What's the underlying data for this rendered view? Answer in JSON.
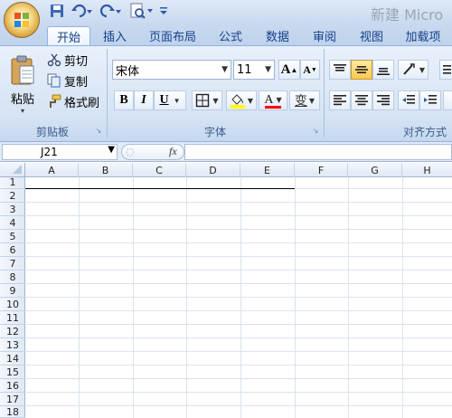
{
  "title_bar": {
    "title": "新建 Micro"
  },
  "tabs": [
    {
      "label": "开始"
    },
    {
      "label": "插入"
    },
    {
      "label": "页面布局"
    },
    {
      "label": "公式"
    },
    {
      "label": "数据"
    },
    {
      "label": "审阅"
    },
    {
      "label": "视图"
    },
    {
      "label": "加载项"
    }
  ],
  "clipboard": {
    "paste_label": "粘贴",
    "cut_label": "剪切",
    "copy_label": "复制",
    "format_painter_label": "格式刷",
    "group_label": "剪贴板"
  },
  "font": {
    "font_name": "宋体",
    "font_size": "11",
    "grow_label": "A",
    "shrink_label": "A",
    "bold_label": "B",
    "italic_label": "I",
    "underline_label": "U",
    "font_color_label": "A",
    "phonetic_label": "变",
    "group_label": "字体"
  },
  "alignment": {
    "group_label": "对齐方式"
  },
  "formula_bar": {
    "name_box": "J21",
    "fx_label": "fx",
    "formula": ""
  },
  "columns": [
    "A",
    "B",
    "C",
    "D",
    "E",
    "F",
    "G",
    "H"
  ],
  "rows": [
    "1",
    "2",
    "3",
    "4",
    "5",
    "6",
    "7",
    "8",
    "9",
    "10",
    "11",
    "12",
    "13",
    "14",
    "15",
    "16",
    "17",
    "18"
  ],
  "colors": {
    "ribbon_blue": "#15428b",
    "highlight_yellow": "#ffff00",
    "font_red": "#ff0000"
  }
}
